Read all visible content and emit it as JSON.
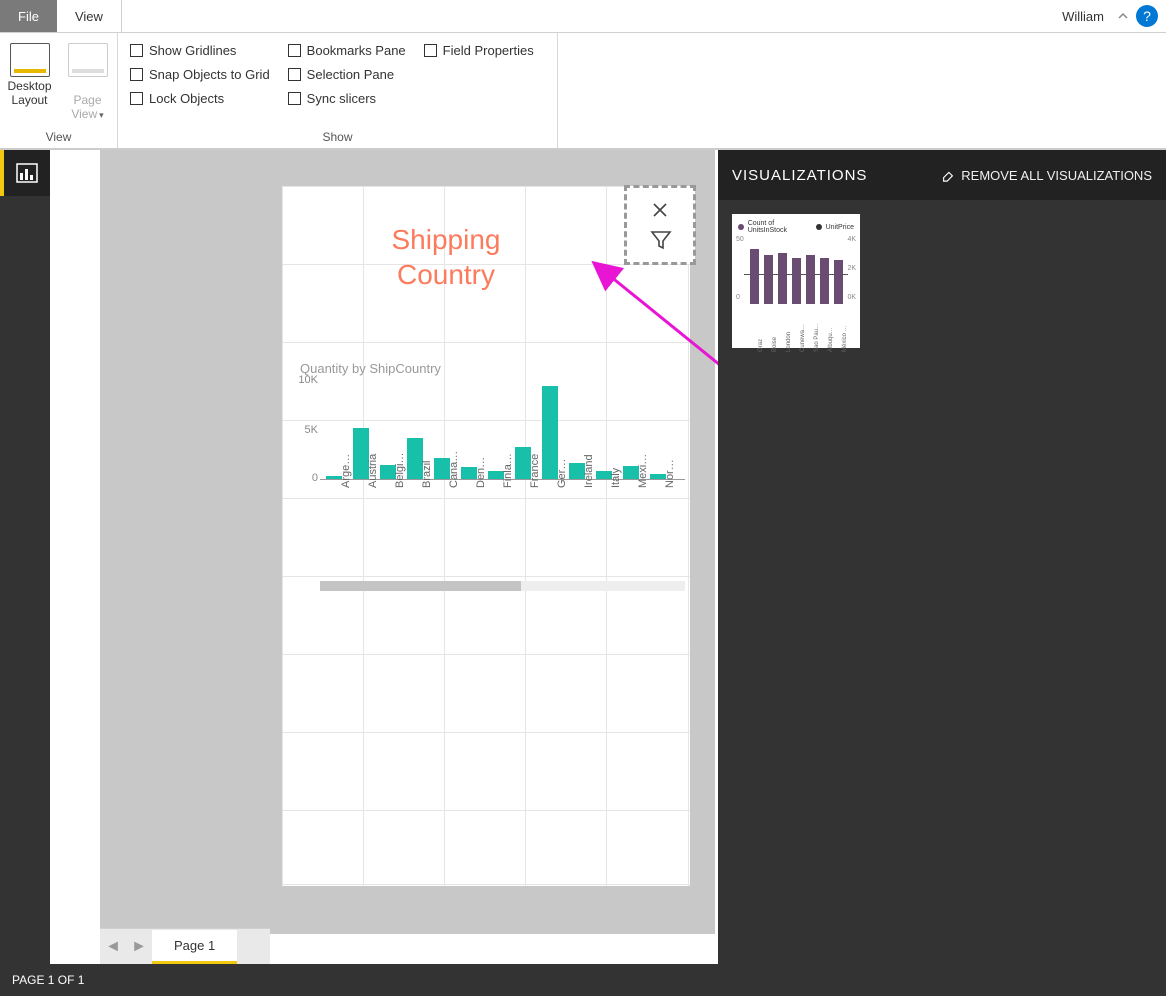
{
  "app": {
    "tabs": {
      "file": "File",
      "view": "View"
    },
    "user": "William"
  },
  "ribbon": {
    "view_group_label": "View",
    "show_group_label": "Show",
    "desktop_layout": "Desktop\nLayout",
    "page_view": "Page\nView",
    "checks": {
      "show_gridlines": "Show Gridlines",
      "snap_to_grid": "Snap Objects to Grid",
      "lock_objects": "Lock Objects",
      "bookmarks_pane": "Bookmarks Pane",
      "selection_pane": "Selection Pane",
      "sync_slicers": "Sync slicers",
      "field_properties": "Field Properties"
    }
  },
  "canvas": {
    "tile_title_line1": "Shipping",
    "tile_title_line2": "Country"
  },
  "chart_data": {
    "type": "bar",
    "title": "Quantity by ShipCountry",
    "ylabel": "",
    "ylim": [
      0,
      10000
    ],
    "yticks": [
      0,
      5000,
      10000
    ],
    "ytick_labels": [
      "0",
      "5K",
      "10K"
    ],
    "categories": [
      "Arge…",
      "Austria",
      "Belgi…",
      "Brazil",
      "Cana…",
      "Den…",
      "Finla…",
      "France",
      "Ger…",
      "Ireland",
      "Italy",
      "Mexi…",
      "Nor…"
    ],
    "values": [
      350,
      5100,
      1400,
      4100,
      2100,
      1200,
      800,
      3200,
      9300,
      1600,
      800,
      1300,
      500
    ]
  },
  "vis_panel": {
    "title": "VISUALIZATIONS",
    "remove_label": "REMOVE ALL VISUALIZATIONS",
    "thumb": {
      "legend1": "Count of UnitsInStock",
      "legend2": "UnitPrice",
      "ylabels": [
        "0",
        "50"
      ],
      "yrlabels": [
        "0K",
        "2K",
        "4K"
      ],
      "categories": [
        "Graz",
        "Boise",
        "London",
        "Cunewa…",
        "Sao Pau…",
        "Albuqu…",
        "México …"
      ],
      "values": [
        47,
        42,
        44,
        40,
        42,
        40,
        38
      ]
    }
  },
  "pages": {
    "tab1": "Page 1"
  },
  "status": {
    "text": "PAGE 1 OF 1"
  }
}
